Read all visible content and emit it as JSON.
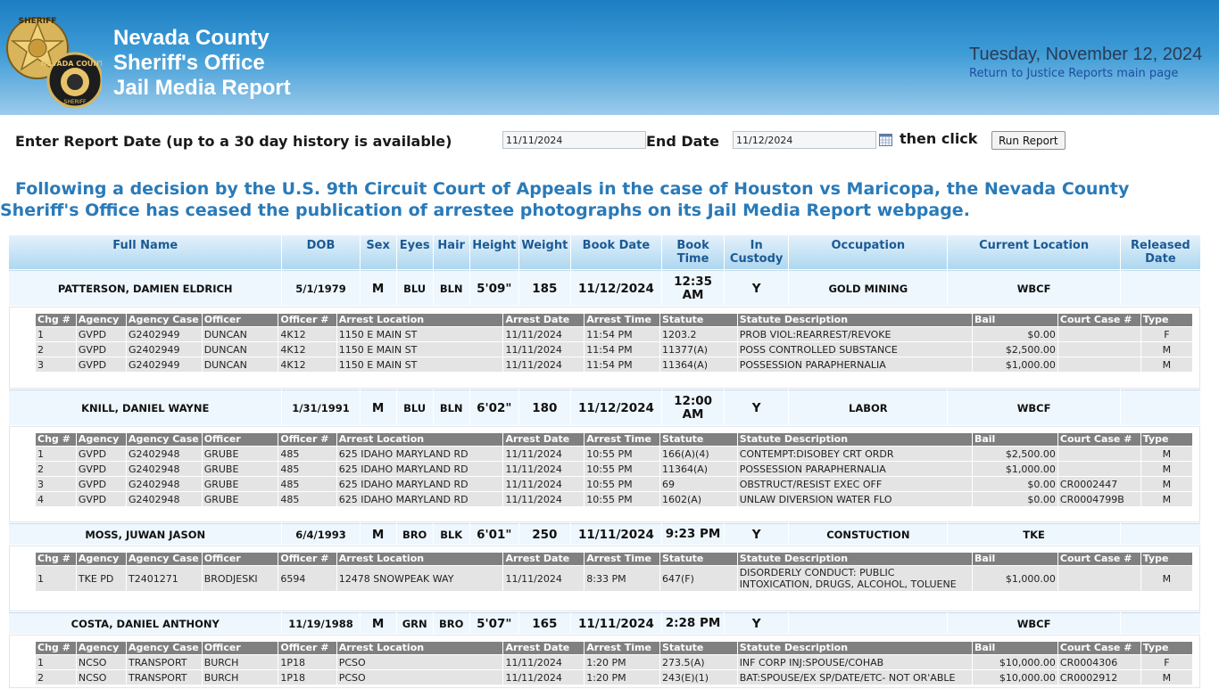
{
  "header": {
    "org_line1": "Nevada County",
    "org_line2": "Sheriff's Office",
    "org_line3": "Jail Media Report",
    "badge_text_top": "SHERIFF",
    "badge_text_side": "NEVADA COUNTY",
    "badge2_text": "NEVADA COUNTY",
    "badge2_sub": "SHERIFF",
    "current_date": "Tuesday, November 12, 2024",
    "back_link": "Return to Justice Reports main page"
  },
  "date_row": {
    "start_label": "Enter Report Date (up to a 30 day history is available)",
    "start_value": "11/11/2024",
    "end_label": "End Date",
    "end_value": "11/12/2024",
    "then_click": "then click",
    "run_button": "Run Report"
  },
  "notice": "Following a decision by the U.S. 9th Circuit Court of Appeals in the case of Houston vs Maricopa, the Nevada County Sheriff's Office has ceased the publication of arrestee photographs on its Jail Media Report webpage.",
  "table_headers": {
    "full_name": "Full Name",
    "dob": "DOB",
    "sex": "Sex",
    "eyes": "Eyes",
    "hair": "Hair",
    "height": "Height",
    "weight": "Weight",
    "book_date": "Book Date",
    "book_time": "Book Time",
    "in_custody": "In Custody",
    "occupation": "Occupation",
    "current_location": "Current Location",
    "released_date": "Released Date"
  },
  "charge_headers": {
    "chg": "Chg #",
    "agency": "Agency",
    "agency_case": "Agency Case",
    "officer": "Officer",
    "officer_num": "Officer #",
    "arrest_location": "Arrest Location",
    "arrest_date": "Arrest Date",
    "arrest_time": "Arrest Time",
    "statute": "Statute",
    "statute_desc": "Statute Description",
    "bail": "Bail",
    "court_case": "Court Case #",
    "type": "Type"
  },
  "inmates": [
    {
      "name": "PATTERSON, DAMIEN ELDRICH",
      "dob": "5/1/1979",
      "sex": "M",
      "eyes": "BLU",
      "hair": "BLN",
      "height": "5'09\"",
      "weight": "185",
      "book_date": "11/12/2024",
      "book_time": "12:35 AM",
      "in_custody": "Y",
      "occupation": "GOLD MINING",
      "location": "WBCF",
      "released": "",
      "charges": [
        {
          "chg": "1",
          "agency": "GVPD",
          "agency_case": "G2402949",
          "officer": "DUNCAN",
          "officer_num": "4K12",
          "location": "1150 E MAIN ST",
          "date": "11/11/2024",
          "time": "11:54 PM",
          "statute": "1203.2",
          "desc": "PROB VIOL:REARREST/REVOKE",
          "bail": "$0.00",
          "court_case": "",
          "type": "F"
        },
        {
          "chg": "2",
          "agency": "GVPD",
          "agency_case": "G2402949",
          "officer": "DUNCAN",
          "officer_num": "4K12",
          "location": "1150 E MAIN ST",
          "date": "11/11/2024",
          "time": "11:54 PM",
          "statute": "11377(A)",
          "desc": "POSS CONTROLLED SUBSTANCE",
          "bail": "$2,500.00",
          "court_case": "",
          "type": "M"
        },
        {
          "chg": "3",
          "agency": "GVPD",
          "agency_case": "G2402949",
          "officer": "DUNCAN",
          "officer_num": "4K12",
          "location": "1150 E MAIN ST",
          "date": "11/11/2024",
          "time": "11:54 PM",
          "statute": "11364(A)",
          "desc": "POSSESSION PARAPHERNALIA",
          "bail": "$1,000.00",
          "court_case": "",
          "type": "M"
        }
      ]
    },
    {
      "name": "KNILL, DANIEL WAYNE",
      "dob": "1/31/1991",
      "sex": "M",
      "eyes": "BLU",
      "hair": "BLN",
      "height": "6'02\"",
      "weight": "180",
      "book_date": "11/12/2024",
      "book_time": "12:00 AM",
      "in_custody": "Y",
      "occupation": "LABOR",
      "location": "WBCF",
      "released": "",
      "charges": [
        {
          "chg": "1",
          "agency": "GVPD",
          "agency_case": "G2402948",
          "officer": "GRUBE",
          "officer_num": "485",
          "location": "625 IDAHO MARYLAND RD",
          "date": "11/11/2024",
          "time": "10:55 PM",
          "statute": "166(A)(4)",
          "desc": "CONTEMPT:DISOBEY CRT ORDR",
          "bail": "$2,500.00",
          "court_case": "",
          "type": "M"
        },
        {
          "chg": "2",
          "agency": "GVPD",
          "agency_case": "G2402948",
          "officer": "GRUBE",
          "officer_num": "485",
          "location": "625 IDAHO MARYLAND RD",
          "date": "11/11/2024",
          "time": "10:55 PM",
          "statute": "11364(A)",
          "desc": "POSSESSION PARAPHERNALIA",
          "bail": "$1,000.00",
          "court_case": "",
          "type": "M"
        },
        {
          "chg": "3",
          "agency": "GVPD",
          "agency_case": "G2402948",
          "officer": "GRUBE",
          "officer_num": "485",
          "location": "625 IDAHO MARYLAND RD",
          "date": "11/11/2024",
          "time": "10:55 PM",
          "statute": "69",
          "desc": "OBSTRUCT/RESIST EXEC OFF",
          "bail": "$0.00",
          "court_case": "CR0002447",
          "type": "M"
        },
        {
          "chg": "4",
          "agency": "GVPD",
          "agency_case": "G2402948",
          "officer": "GRUBE",
          "officer_num": "485",
          "location": "625 IDAHO MARYLAND RD",
          "date": "11/11/2024",
          "time": "10:55 PM",
          "statute": "1602(A)",
          "desc": "UNLAW DIVERSION WATER FLO",
          "bail": "$0.00",
          "court_case": "CR0004799B",
          "type": "M"
        }
      ]
    },
    {
      "name": "MOSS, JUWAN JASON",
      "dob": "6/4/1993",
      "sex": "M",
      "eyes": "BRO",
      "hair": "BLK",
      "height": "6'01\"",
      "weight": "250",
      "book_date": "11/11/2024",
      "book_time": "9:23 PM",
      "in_custody": "Y",
      "occupation": "CONSTUCTION",
      "location": "TKE",
      "released": "",
      "charges": [
        {
          "chg": "1",
          "agency": "TKE PD",
          "agency_case": "T2401271",
          "officer": "BRODJESKI",
          "officer_num": "6594",
          "location": "12478 SNOWPEAK WAY",
          "date": "11/11/2024",
          "time": "8:33 PM",
          "statute": "647(F)",
          "desc": "DISORDERLY CONDUCT: PUBLIC INTOXICATION, DRUGS, ALCOHOL, TOLUENE",
          "bail": "$1,000.00",
          "court_case": "",
          "type": "M"
        }
      ]
    },
    {
      "name": "COSTA, DANIEL ANTHONY",
      "dob": "11/19/1988",
      "sex": "M",
      "eyes": "GRN",
      "hair": "BRO",
      "height": "5'07\"",
      "weight": "165",
      "book_date": "11/11/2024",
      "book_time": "2:28 PM",
      "in_custody": "Y",
      "occupation": "",
      "location": "WBCF",
      "released": "",
      "charges": [
        {
          "chg": "1",
          "agency": "NCSO",
          "agency_case": "TRANSPORT",
          "officer": "BURCH",
          "officer_num": "1P18",
          "location": "PCSO",
          "date": "11/11/2024",
          "time": "1:20 PM",
          "statute": "273.5(A)",
          "desc": "INF CORP INJ:SPOUSE/COHAB",
          "bail": "$10,000.00",
          "court_case": "CR0004306",
          "type": "F"
        },
        {
          "chg": "2",
          "agency": "NCSO",
          "agency_case": "TRANSPORT",
          "officer": "BURCH",
          "officer_num": "1P18",
          "location": "PCSO",
          "date": "11/11/2024",
          "time": "1:20 PM",
          "statute": "243(E)(1)",
          "desc": "BAT:SPOUSE/EX SP/DATE/ETC- NOT OR'ABLE",
          "bail": "$10,000.00",
          "court_case": "CR0002912",
          "type": "M"
        }
      ]
    }
  ]
}
